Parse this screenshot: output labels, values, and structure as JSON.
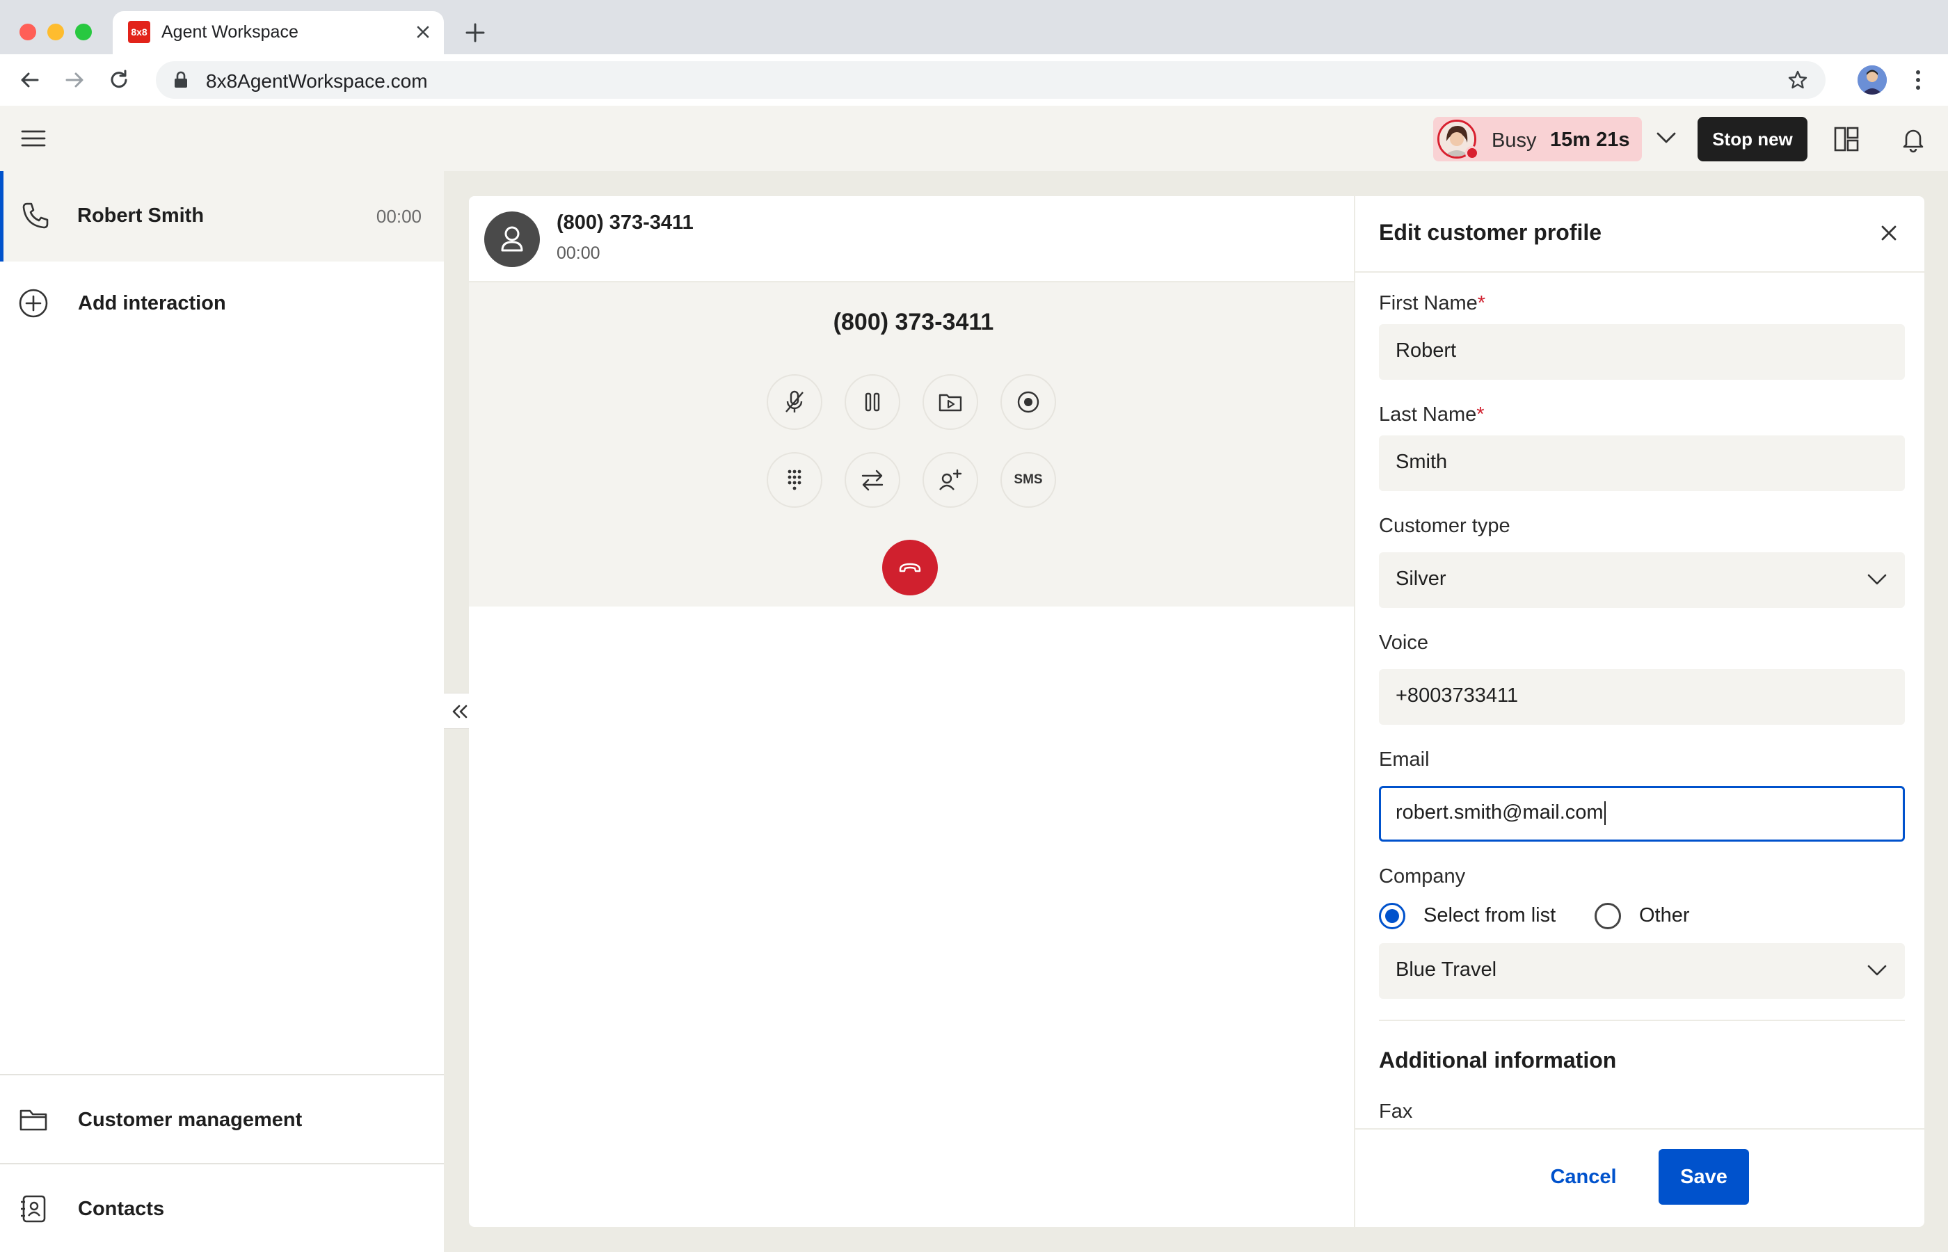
{
  "browser": {
    "tab_title": "Agent Workspace",
    "favicon_text": "8x8",
    "url": "8x8AgentWorkspace.com"
  },
  "header": {
    "status_label": "Busy",
    "status_timer": "15m 21s",
    "stop_button": "Stop new"
  },
  "sidebar": {
    "active_interaction": {
      "name": "Robert Smith",
      "time": "00:00"
    },
    "add_interaction": "Add interaction",
    "bottom_items": [
      {
        "label": "Customer management",
        "icon": "folder-icon"
      },
      {
        "label": "Contacts",
        "icon": "contacts-book-icon"
      }
    ]
  },
  "call": {
    "number": "(800) 373-3411",
    "elapsed": "00:00",
    "big_number": "(800) 373-3411",
    "controls_row1": [
      "mute-icon",
      "hold-icon",
      "screen-share-icon",
      "record-icon"
    ],
    "controls_row2": [
      "dialpad-icon",
      "transfer-icon",
      "add-participant-icon",
      "sms-button"
    ],
    "sms_label": "SMS"
  },
  "panel": {
    "title": "Edit customer profile",
    "required_mark": "*",
    "first_name": {
      "label": "First Name",
      "value": "Robert"
    },
    "last_name": {
      "label": "Last Name",
      "value": "Smith"
    },
    "customer_type": {
      "label": "Customer type",
      "value": "Silver"
    },
    "voice": {
      "label": "Voice",
      "value": "+8003733411"
    },
    "email": {
      "label": "Email",
      "value": "robert.smith@mail.com"
    },
    "company": {
      "label": "Company",
      "option_list": "Select from list",
      "option_other": "Other",
      "selected_option": "Select from list",
      "value": "Blue Travel"
    },
    "additional_title": "Additional information",
    "fax_label": "Fax",
    "cancel": "Cancel",
    "save": "Save"
  },
  "colors": {
    "accent": "#0052cc",
    "danger": "#d0202e",
    "busy_bg": "#f9d2d4",
    "app_bg": "#ecebe4"
  }
}
